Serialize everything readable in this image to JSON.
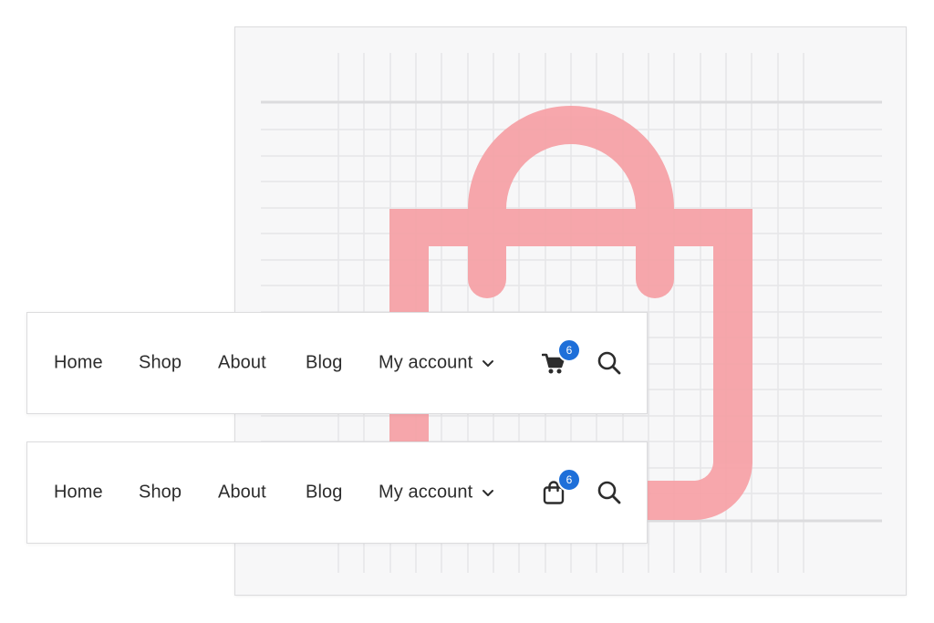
{
  "navbars": [
    {
      "items": [
        "Home",
        "Shop",
        "About",
        "Blog",
        "My account"
      ],
      "cart_icon": "shopping-cart-icon",
      "cart_count": "6",
      "search_icon": "search-icon"
    },
    {
      "items": [
        "Home",
        "Shop",
        "About",
        "Blog",
        "My account"
      ],
      "cart_icon": "shopping-bag-icon",
      "cart_count": "6",
      "search_icon": "search-icon"
    }
  ],
  "illustration": {
    "icon": "shopping-bag-icon",
    "bag_color": "#f6a0a5",
    "grid_color": "#e6e6e8",
    "guide_color": "#dcdcde"
  },
  "colors": {
    "badge": "#1e6fd9",
    "text": "#2c2c2c"
  }
}
